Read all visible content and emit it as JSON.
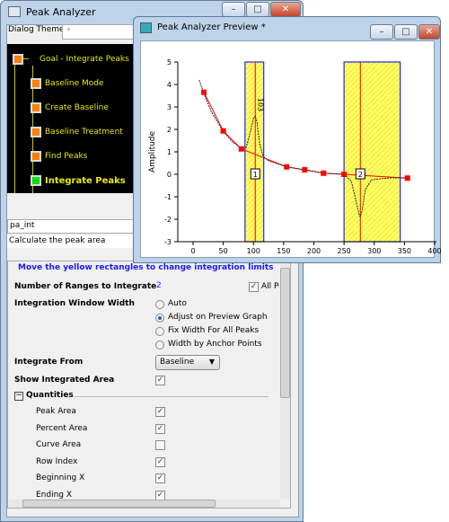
{
  "main_window": {
    "title": "Peak Analyzer",
    "dialog_theme_label": "Dialog Theme",
    "dialog_theme_value": "*",
    "tree": [
      {
        "label": "Goal - Integrate Peaks",
        "state": "orange"
      },
      {
        "label": "Baseline Mode",
        "state": "orange"
      },
      {
        "label": "Create Baseline",
        "state": "orange"
      },
      {
        "label": "Baseline Treatment",
        "state": "orange"
      },
      {
        "label": "Find Peaks",
        "state": "orange"
      },
      {
        "label": "Integrate Peaks",
        "state": "green",
        "current": true
      }
    ],
    "page_name": "pa_int",
    "page_desc": "Calculate the peak area",
    "hint": "Move the yellow rectangles to change integration limits",
    "num_ranges_label": "Number of Ranges to Integrate",
    "num_ranges_value": "2",
    "all_peaks_label": "All Pe",
    "window_width_label": "Integration Window Width",
    "window_width_options": [
      "Auto",
      "Adjust on Preview Graph",
      "Fix Width For All Peaks",
      "Width by Anchor Points"
    ],
    "window_width_selected": 1,
    "integrate_from_label": "Integrate From",
    "integrate_from_value": "Baseline",
    "show_area_label": "Show Integrated Area",
    "show_area_checked": true,
    "quantities_label": "Quantities",
    "quantities": [
      {
        "label": "Peak Area",
        "checked": true
      },
      {
        "label": "Percent Area",
        "checked": true
      },
      {
        "label": "Curve Area",
        "checked": false
      },
      {
        "label": "Row Index",
        "checked": true
      },
      {
        "label": "Beginning X",
        "checked": true
      },
      {
        "label": "Ending X",
        "checked": true
      }
    ]
  },
  "preview_window": {
    "title": "Peak Analyzer Preview *"
  },
  "chart_data": {
    "type": "line",
    "ylabel": "Amplitude",
    "xlabel": "",
    "xlim": [
      0,
      400
    ],
    "ylim": [
      -3,
      5
    ],
    "xticks": [
      "0",
      "50",
      "100",
      "150",
      "200",
      "250",
      "300",
      "350",
      "400"
    ],
    "yticks": [
      "-3",
      "-2",
      "-1",
      "0",
      "1",
      "2",
      "3",
      "4",
      "5"
    ],
    "signal": {
      "x": [
        10,
        18,
        30,
        50,
        65,
        80,
        88,
        95,
        100,
        103,
        106,
        110,
        116,
        125,
        155,
        185,
        216,
        250,
        262,
        270,
        275,
        277,
        280,
        285,
        295,
        310,
        330,
        355
      ],
      "y": [
        4.2,
        3.6,
        2.8,
        1.9,
        1.45,
        1.15,
        1.2,
        1.9,
        2.5,
        2.6,
        2.3,
        1.4,
        0.8,
        0.6,
        0.33,
        0.2,
        0.05,
        0,
        -0.3,
        -1.2,
        -1.8,
        -1.9,
        -1.6,
        -0.7,
        -0.25,
        -0.2,
        -0.15,
        -0.17
      ]
    },
    "baseline_anchors": {
      "x": [
        18,
        50,
        80,
        155,
        185,
        216,
        250,
        355
      ],
      "y": [
        3.65,
        1.93,
        1.13,
        0.33,
        0.2,
        0.05,
        0,
        -0.17
      ]
    },
    "integration_ranges": [
      {
        "label": "1",
        "from": 86,
        "to": 117,
        "center": 103
      },
      {
        "label": "2",
        "from": 250,
        "to": 343,
        "center": 277
      }
    ],
    "peak_labels": [
      {
        "x": 103,
        "text": "103"
      }
    ],
    "colors": {
      "range_fill": "#ffff66",
      "range_border": "#2222ff",
      "center_line": "#ff0000",
      "baseline": "#ff0000",
      "signal": "#000000"
    }
  }
}
